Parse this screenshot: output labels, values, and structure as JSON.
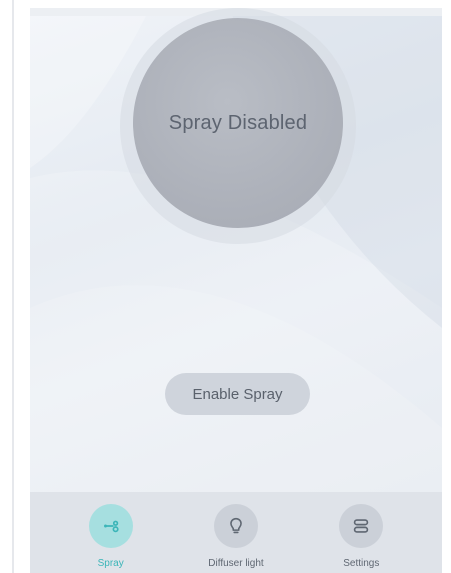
{
  "spray": {
    "status_text": "Spray Disabled",
    "enable_label": "Enable Spray"
  },
  "nav": {
    "items": [
      {
        "label": "Spray",
        "icon": "spray-icon",
        "active": true
      },
      {
        "label": "Diffuser light",
        "icon": "bulb-icon",
        "active": false
      },
      {
        "label": "Settings",
        "icon": "settings-icon",
        "active": false
      }
    ]
  },
  "colors": {
    "accent": "#3bb5b8",
    "accent_bg": "#a6dfe0",
    "disabled_circle": "#adb1ba",
    "button_bg": "#cfd4dc",
    "nav_bg": "#dfe3e9"
  }
}
